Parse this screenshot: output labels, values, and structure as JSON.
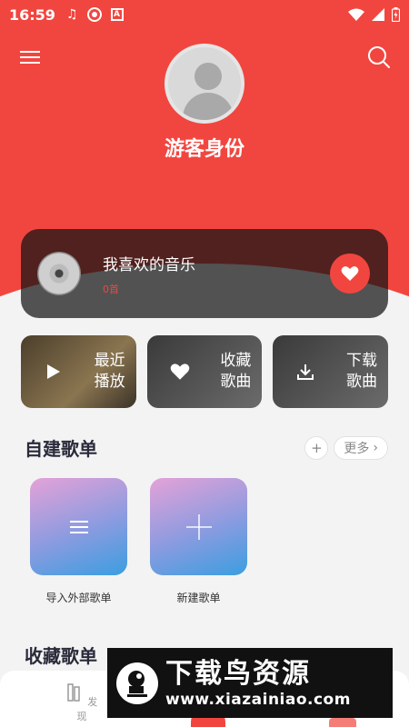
{
  "status_bar": {
    "time": "16:59"
  },
  "profile": {
    "username": "游客身份"
  },
  "favorites": {
    "title": "我喜欢的音乐",
    "count": "0首"
  },
  "quick_actions": [
    {
      "line1": "最近",
      "line2": "播放"
    },
    {
      "line1": "收藏",
      "line2": "歌曲"
    },
    {
      "line1": "下载",
      "line2": "歌曲"
    }
  ],
  "my_playlists": {
    "title": "自建歌单",
    "add_label": "+",
    "more_label": "更多",
    "items": [
      {
        "name": "导入外部歌单"
      },
      {
        "name": "新建歌单"
      }
    ]
  },
  "collected_playlists": {
    "title": "收藏歌单"
  },
  "bottom_nav": {
    "discover_label": "发现"
  },
  "watermark": {
    "title": "下载鸟资源",
    "url": "www.xiazainiao.com"
  },
  "colors": {
    "accent": "#f1463f",
    "background": "#f3f3f4"
  }
}
